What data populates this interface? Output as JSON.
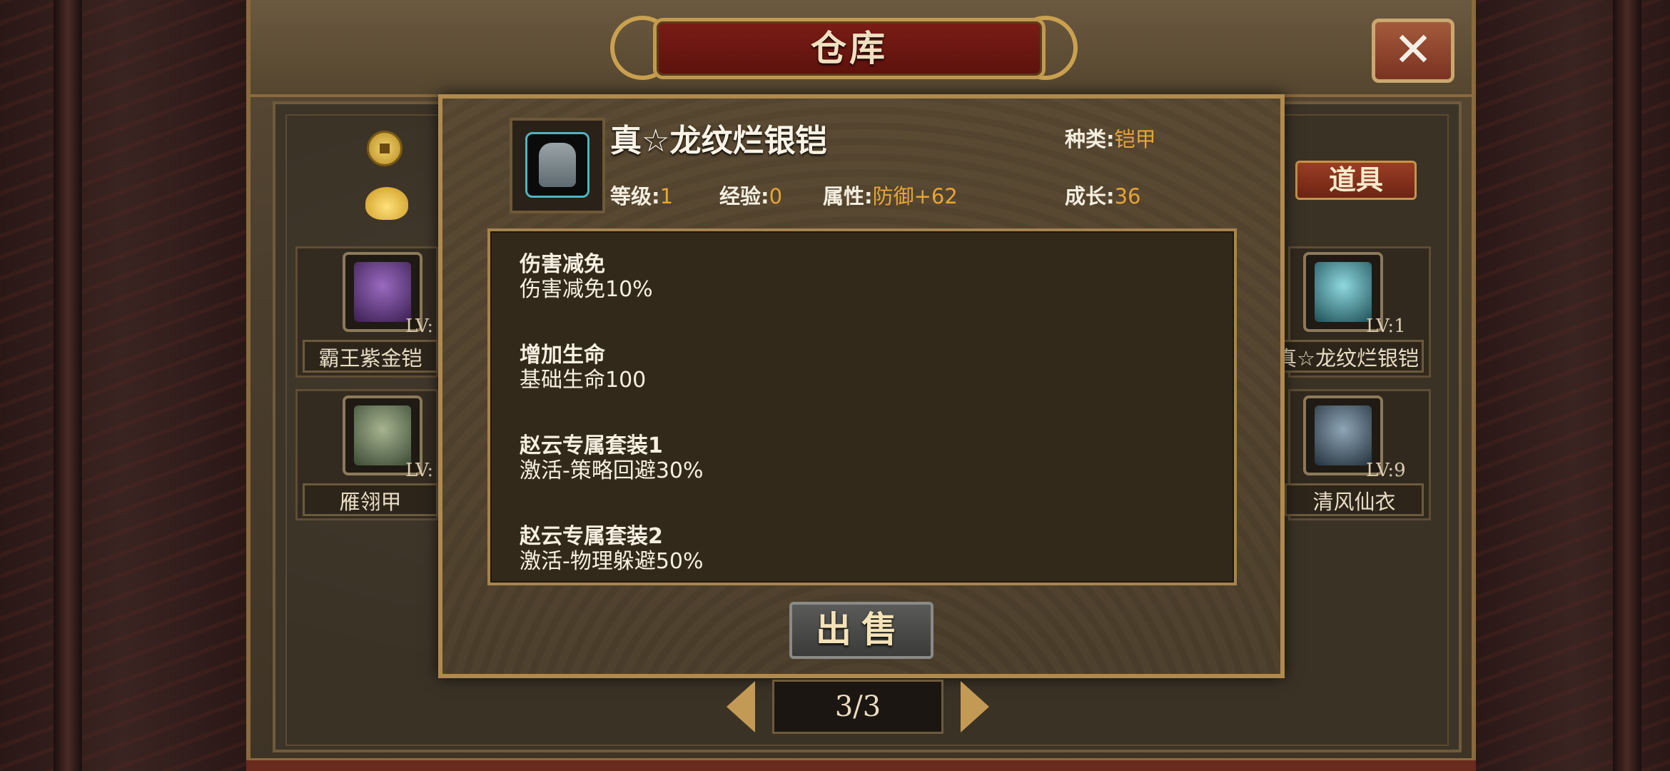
{
  "window": {
    "title": "仓库",
    "close_label": "✕"
  },
  "tabs": {
    "items_label": "道具"
  },
  "slots": [
    {
      "name": "霸王紫金铠",
      "level": "LV:",
      "art_color": "#6a3e8c"
    },
    {
      "name": "雁翎甲",
      "level": "LV:",
      "art_color": "#7a8a70"
    },
    {
      "name": "真☆龙纹烂银铠",
      "level": "LV:1",
      "art_color": "#4db6c1"
    },
    {
      "name": "清风仙衣",
      "level": "LV:9",
      "art_color": "#5a6e80"
    }
  ],
  "detail": {
    "name": "真☆龙纹烂银铠",
    "type_label": "种类:",
    "type_value": "铠甲",
    "level_label": "等级:",
    "level_value": "1",
    "exp_label": "经验:",
    "exp_value": "0",
    "attr_label": "属性:",
    "attr_value": "防御+62",
    "growth_label": "成长:",
    "growth_value": "36",
    "effects": [
      {
        "title": "伤害减免",
        "desc": "伤害减免10%"
      },
      {
        "title": "增加生命",
        "desc": "基础生命100"
      },
      {
        "title": "赵云专属套装1",
        "desc": "激活-策略回避30%"
      },
      {
        "title": "赵云专属套装2",
        "desc": "激活-物理躲避50%"
      }
    ],
    "sell_label": "出售"
  },
  "pagination": {
    "text": "3/3"
  },
  "colors": {
    "accent_gold": "#e7a535",
    "title_red": "#7a1d16",
    "frame_gold": "#b08a4c"
  }
}
